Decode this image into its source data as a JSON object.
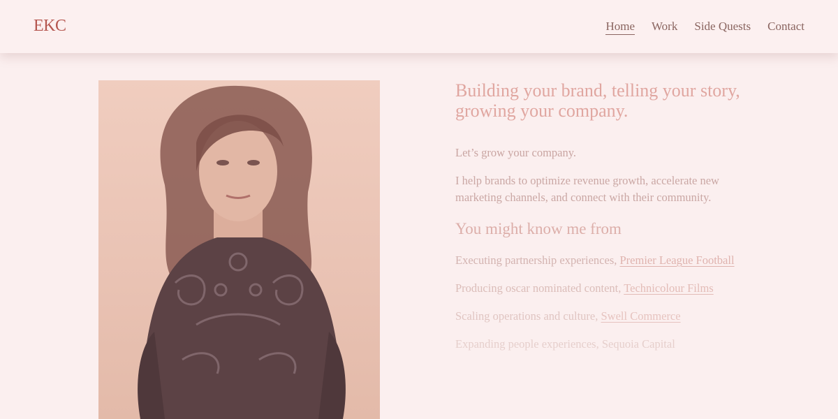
{
  "header": {
    "logo": "EKC",
    "nav": [
      {
        "label": "Home",
        "active": true
      },
      {
        "label": "Work",
        "active": false
      },
      {
        "label": "Side Quests",
        "active": false
      },
      {
        "label": "Contact",
        "active": false
      }
    ]
  },
  "hero": {
    "headline": "Building your brand, telling your story, growing your company.",
    "intro": "Let’s grow your company.",
    "description": "I help brands to optimize revenue growth, accelerate new marketing channels, and connect with their community.",
    "subheading": "You might know me from",
    "experiences": [
      {
        "text": "Executing partnership experiences, ",
        "link": "Premier League Football"
      },
      {
        "text": "Producing oscar nominated content, ",
        "link": "Technicolour Films"
      },
      {
        "text": "Scaling operations and culture, ",
        "link": "Swell Commerce"
      },
      {
        "text": "Expanding people experiences, Sequoia Capital",
        "link": ""
      }
    ]
  },
  "colors": {
    "background": "#fbefef",
    "logo": "#b5564f",
    "nav_text": "#8a6560",
    "headline": "#e0a6a0"
  }
}
